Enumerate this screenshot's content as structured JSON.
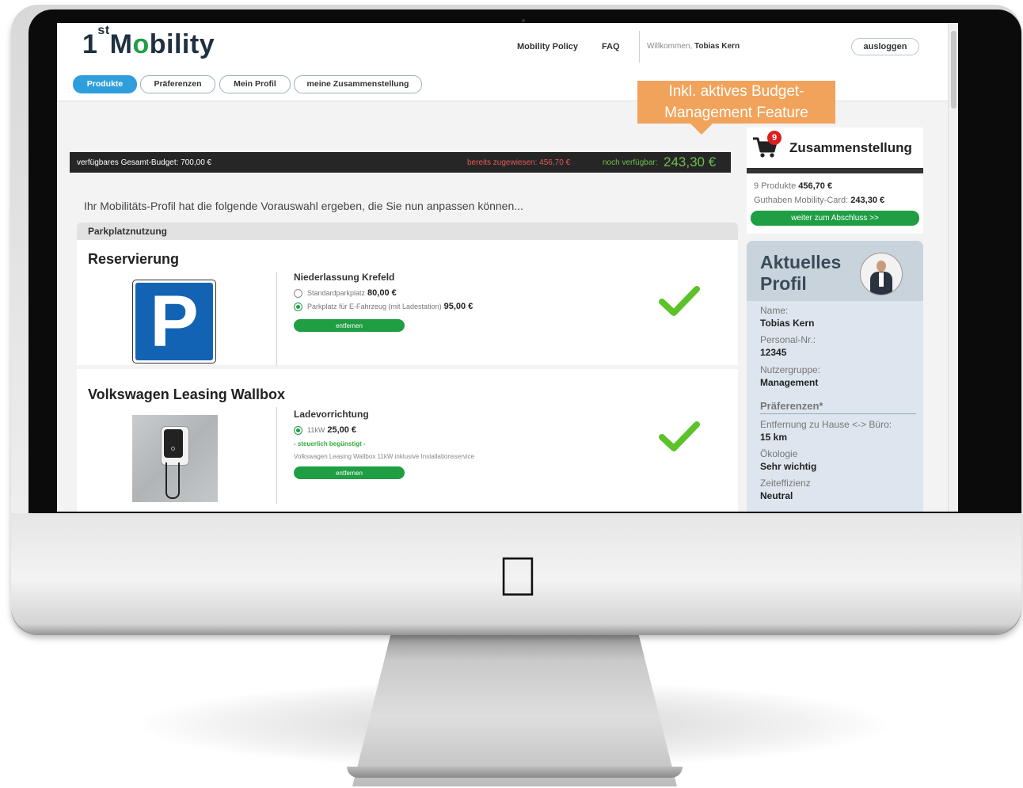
{
  "header": {
    "logo_prefix": "1",
    "logo_sup": "st",
    "logo_rest_a": "M",
    "logo_pin": "o",
    "logo_rest_b": "bility",
    "nav": [
      "Mobility Policy",
      "FAQ"
    ],
    "welcome_label": "Willkommen,",
    "user_name": "Tobias Kern",
    "logout_label": "ausloggen",
    "tabs": [
      {
        "label": "Produkte",
        "active": true
      },
      {
        "label": "Präferenzen",
        "active": false
      },
      {
        "label": "Mein Profil",
        "active": false
      },
      {
        "label": "meine Zusammenstellung",
        "active": false
      }
    ]
  },
  "callout": {
    "line1": "Inkl. aktives Budget-",
    "line2": "Management Feature",
    "color": "#f2a35b"
  },
  "budget": {
    "total_label": "verfügbares Gesamt-Budget:",
    "total_value": "700,00 €",
    "assigned_label": "bereits zugewiesen:",
    "assigned_value": "456,70 €",
    "remaining_label": "noch verfügbar:",
    "remaining_value": "243,30 €"
  },
  "intro": "Ihr Mobilitäts-Profil hat die folgende Vorauswahl ergeben, die Sie nun anpassen können...",
  "section": {
    "title": "Parkplatznutzung",
    "cards": [
      {
        "title": "Reservierung",
        "image_icon": "parking-sign-icon",
        "option_title": "Niederlassung Krefeld",
        "options": [
          {
            "label": "Standardparkplatz",
            "price": "80,00 €",
            "selected": false
          },
          {
            "label": "Parkplatz für E-Fahrzeug (mit Ladestation)",
            "price": "95,00 €",
            "selected": true
          }
        ],
        "remove_label": "entfernen"
      },
      {
        "title": "Volkswagen Leasing Wallbox",
        "image_icon": "wallbox-photo",
        "option_title": "Ladevorrichtung",
        "options": [
          {
            "label": "11kW",
            "price": "25,00 €",
            "selected": true
          }
        ],
        "tax_note": "- steuerlich begünstigt -",
        "description": "Volkswagen Leasing Wallbox 11kW inklusive Installationsservice",
        "remove_label": "entfernen"
      }
    ]
  },
  "cart": {
    "badge_count": "9",
    "title": "Zusammenstellung",
    "products_label": "9 Produkte",
    "products_value": "456,70 €",
    "credit_label": "Guthaben Mobility-Card:",
    "credit_value": "243,30 €",
    "checkout_label": "weiter zum Abschluss >>"
  },
  "profile": {
    "title_line1": "Aktuelles",
    "title_line2": "Profil",
    "fields": [
      {
        "label": "Name:",
        "value": "Tobias Kern"
      },
      {
        "label": "Personal-Nr.:",
        "value": "12345"
      },
      {
        "label": "Nutzergruppe:",
        "value": "Management"
      }
    ],
    "preferences_title": "Präferenzen*",
    "preferences": [
      {
        "label": "Entfernung zu Hause <-> Büro:",
        "value": "15 km"
      },
      {
        "label": "Ökologie",
        "value": "Sehr wichtig"
      },
      {
        "label": "Zeiteffizienz",
        "value": "Neutral"
      }
    ]
  },
  "colors": {
    "accent_blue": "#2f9fdc",
    "accent_green": "#1f9e44",
    "budget_red": "#e85a5a",
    "budget_green": "#6ec04d"
  }
}
